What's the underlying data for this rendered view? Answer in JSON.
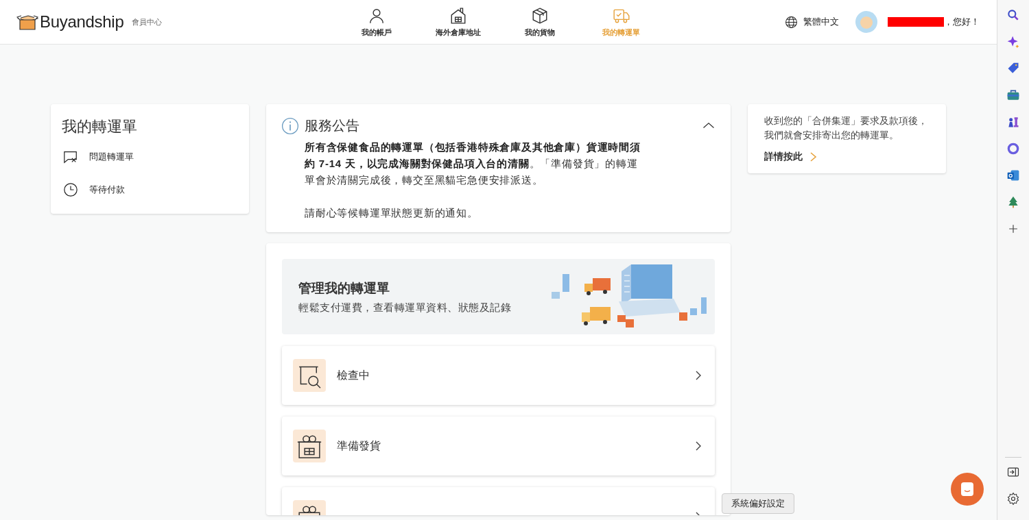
{
  "header": {
    "logo": "Buyandship",
    "subtitle": "會員中心",
    "nav": [
      {
        "label": "我的帳戶",
        "kind": "account",
        "selected": false
      },
      {
        "label": "海外倉庫地址",
        "kind": "warehouse",
        "selected": false
      },
      {
        "label": "我的貨物",
        "kind": "parcel",
        "selected": false
      },
      {
        "label": "我的轉運單",
        "kind": "shipment",
        "selected": true
      }
    ],
    "language": "繁體中文",
    "greeting": "，您好！"
  },
  "sidebar": {
    "title": "我的轉運單",
    "items": [
      {
        "label": "問題轉運單",
        "kind": "problem"
      },
      {
        "label": "等待付款",
        "kind": "pending"
      }
    ]
  },
  "notice": {
    "title": "服務公告",
    "expanded": true,
    "paragraphs": [
      "**所有含保健食品的轉運單（包括香港特殊倉庫及其他倉庫）貨運時間須約 7-14 天，以完成海關對保健品項入台的清關**。「準備發貨」的轉運單會於清關完成後，轉交至黑貓宅急便安排派送。",
      "請耐心等候轉運單狀態更新的通知。"
    ]
  },
  "manage": {
    "title": "管理我的轉運單",
    "subtitle": "輕鬆支付運費，查看轉運單資料、狀態及記錄",
    "statuses": [
      {
        "label": "檢查中",
        "kind": "inspecting"
      },
      {
        "label": "準備發貨",
        "kind": "preparing"
      },
      {
        "kind": "delivery"
      }
    ]
  },
  "info": {
    "text": "收到您的「合併集運」要求及款項後，我們就會安排寄出您的轉運單。",
    "link": "詳情按此"
  },
  "tooltip": "系統偏好設定"
}
